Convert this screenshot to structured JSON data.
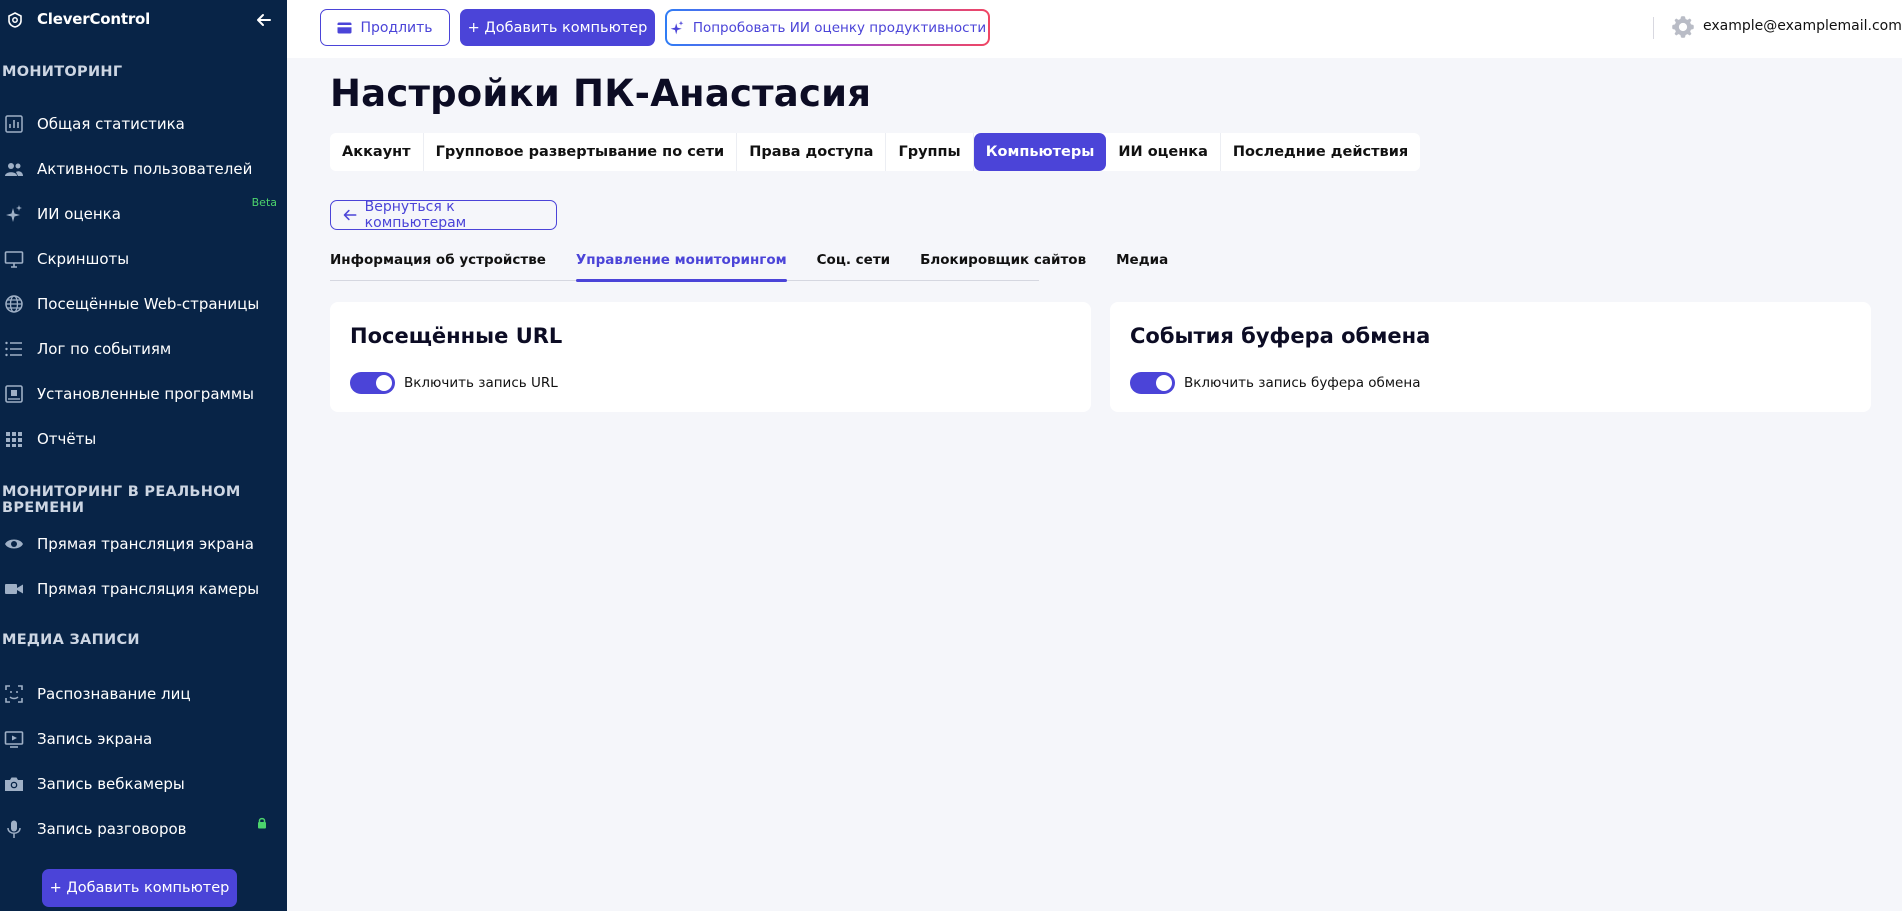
{
  "app": {
    "name": "CleverControl"
  },
  "sidebar": {
    "sections": [
      {
        "title": "МОНИТОРИНГ",
        "items": [
          {
            "label": "Общая статистика",
            "icon": "bar-chart-icon"
          },
          {
            "label": "Активность пользователей",
            "icon": "users-icon"
          },
          {
            "label": "ИИ оценка",
            "icon": "sparkle-icon",
            "badge": "Beta"
          },
          {
            "label": "Скриншоты",
            "icon": "monitor-icon"
          },
          {
            "label": "Посещённые Web-страницы",
            "icon": "globe-icon"
          },
          {
            "label": "Лог по событиям",
            "icon": "list-icon"
          },
          {
            "label": "Установленные программы",
            "icon": "app-box-icon"
          },
          {
            "label": "Отчёты",
            "icon": "grid-icon"
          }
        ]
      },
      {
        "title": "МОНИТОРИНГ В РЕАЛЬНОМ ВРЕМЕНИ",
        "items": [
          {
            "label": "Прямая трансляция экрана",
            "icon": "eye-icon"
          },
          {
            "label": "Прямая трансляция камеры",
            "icon": "video-camera-icon"
          }
        ]
      },
      {
        "title": "МЕДИА ЗАПИСИ",
        "items": [
          {
            "label": "Распознавание лиц",
            "icon": "face-scan-icon"
          },
          {
            "label": "Запись экрана",
            "icon": "screen-play-icon"
          },
          {
            "label": "Запись вебкамеры",
            "icon": "camera-icon"
          },
          {
            "label": "Запись разговоров",
            "icon": "microphone-icon",
            "locked": true
          }
        ]
      }
    ],
    "add_button": "+ Добавить компьютер"
  },
  "topbar": {
    "extend_label": "Продлить",
    "add_label": "+ Добавить компьютер",
    "ai_label": "Попробовать ИИ оценку продуктивности",
    "user_email": "example@examplemail.com"
  },
  "page": {
    "title": "Настройки ПК-Анастасия",
    "tabs": [
      {
        "label": "Аккаунт",
        "active": false
      },
      {
        "label": "Групповое развертывание по сети",
        "active": false
      },
      {
        "label": "Права доступа",
        "active": false
      },
      {
        "label": "Группы",
        "active": false
      },
      {
        "label": "Компьютеры",
        "active": true
      },
      {
        "label": "ИИ оценка",
        "active": false
      },
      {
        "label": "Последние действия",
        "active": false
      }
    ],
    "back_label": "Вернуться к компьютерам",
    "subtabs": [
      {
        "label": "Информация об устройстве",
        "active": false
      },
      {
        "label": "Управление мониторингом",
        "active": true
      },
      {
        "label": "Соц. сети",
        "active": false
      },
      {
        "label": "Блокировщик сайтов",
        "active": false
      },
      {
        "label": "Медиа",
        "active": false
      }
    ],
    "cards": [
      {
        "title": "Посещённые URL",
        "toggle_label": "Включить запись URL",
        "enabled": true
      },
      {
        "title": "События буфера обмена",
        "toggle_label": "Включить запись буфера обмена",
        "enabled": true
      }
    ]
  },
  "colors": {
    "sidebar_bg": "#082447",
    "accent": "#4b44d8",
    "beta": "#4cd36c"
  }
}
